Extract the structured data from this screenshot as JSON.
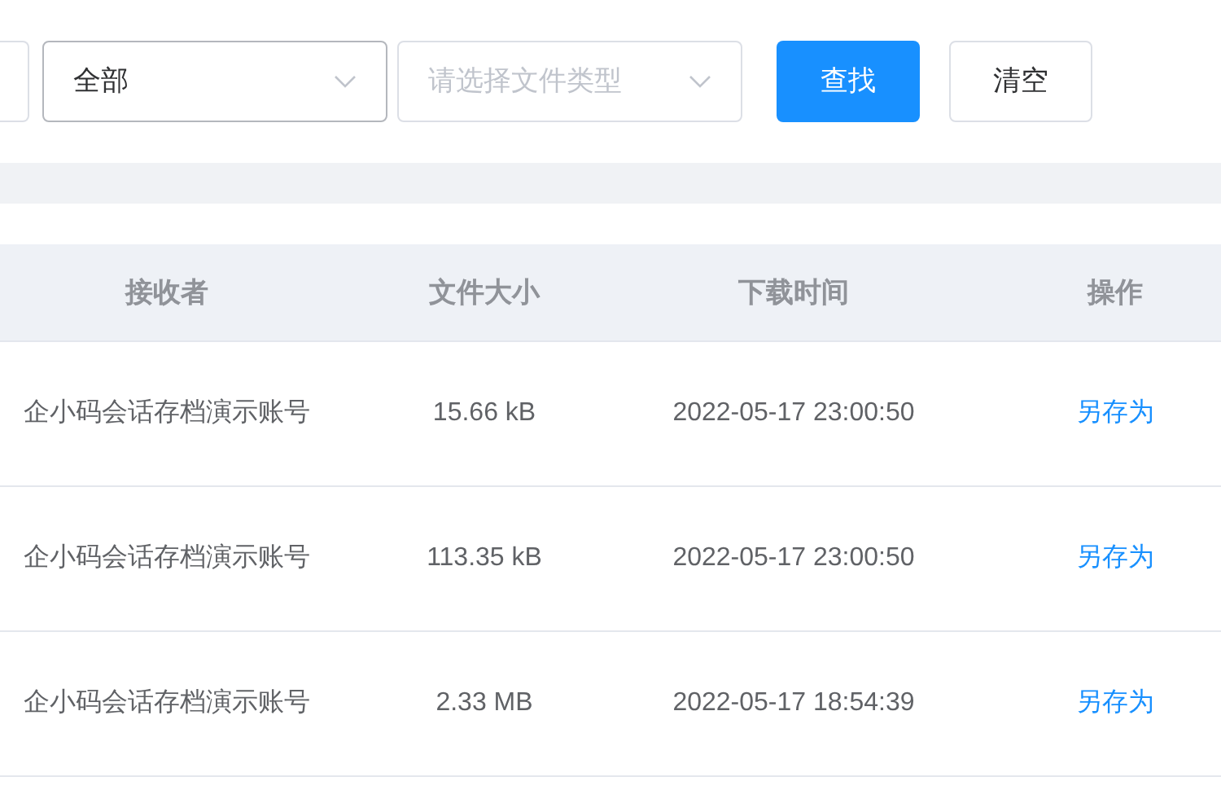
{
  "filters": {
    "type_select": {
      "value": "全部"
    },
    "file_type_select": {
      "placeholder": "请选择文件类型"
    },
    "buttons": [
      {
        "label": "查找",
        "kind": "primary"
      },
      {
        "label": "清空",
        "kind": "default"
      }
    ]
  },
  "table": {
    "columns": [
      "接收者",
      "文件大小",
      "下载时间",
      "操作"
    ],
    "rows": [
      {
        "receiver": "企小码会话存档演示账号",
        "size": "15.66 kB",
        "time": "2022-05-17 23:00:50",
        "action": "另存为"
      },
      {
        "receiver": "企小码会话存档演示账号",
        "size": "113.35 kB",
        "time": "2022-05-17 23:00:50",
        "action": "另存为"
      },
      {
        "receiver": "企小码会话存档演示账号",
        "size": "2.33 MB",
        "time": "2022-05-17 18:54:39",
        "action": "另存为"
      }
    ]
  }
}
